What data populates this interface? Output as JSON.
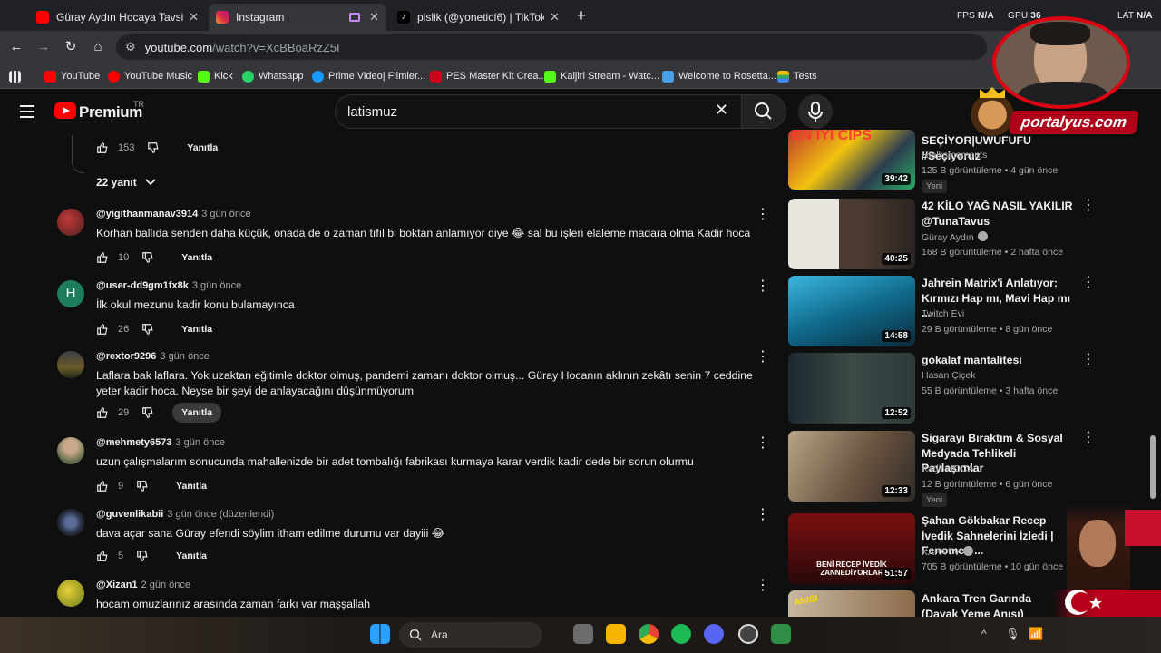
{
  "browser": {
    "tabs": [
      {
        "title": "Güray Aydın Hocaya Tavsiyemdir"
      },
      {
        "title": "Instagram"
      },
      {
        "title": "pislik (@yoneticí6) | TikTok"
      }
    ],
    "stats": {
      "fps_label": "FPS",
      "fps_value": "N/A",
      "gpu_label": "GPU",
      "gpu_value": "36",
      "lat_label": "LAT",
      "lat_value": "N/A"
    },
    "url_host": "youtube.com",
    "url_rest": "/watch?v=XcBBoaRzZ5I",
    "bookmarks": [
      "YouTube",
      "YouTube Music",
      "Kick",
      "Whatsapp",
      "Prime Video| Filmler...",
      "PES Master Kit Crea...",
      "Kaijiri Stream - Watc...",
      "Welcome to Rosetta...",
      "Tests"
    ]
  },
  "header": {
    "logo_text": "Premium",
    "region": "TR",
    "search_value": "latismuz"
  },
  "comments_top": {
    "likes": "153",
    "reply": "Yanıtla",
    "replies_toggle": "22 yanıt"
  },
  "comments": [
    {
      "handle": "@yigithanmanav3914",
      "time": "3 gün önce",
      "text": "Korhan ballıda senden daha küçük, onada de o zaman tıfıl bi boktan anlamıyor diye 😂 sal bu işleri elaleme madara olma Kadir hoca",
      "likes": "10",
      "reply": "Yanıtla"
    },
    {
      "handle": "@user-dd9gm1fx8k",
      "time": "3 gün önce",
      "text": "İlk okul mezunu kadir konu bulamayınca",
      "likes": "26",
      "reply": "Yanıtla",
      "initial": "H"
    },
    {
      "handle": "@rextor9296",
      "time": "3 gün önce",
      "text": "Laflara bak laflara. Yok uzaktan eğitimle doktor olmuş, pandemi zamanı doktor olmuş... Güray Hocanın aklının zekâtı senin 7 ceddine yeter kadir hoca. Neyse bir şeyi de anlayacağını düşünmüyorum",
      "likes": "29",
      "reply": "Yanıtla"
    },
    {
      "handle": "@mehmety6573",
      "time": "3 gün önce",
      "text": "uzun çalışmalarım sonucunda mahallenizde bir adet tombalığı fabrikası kurmaya karar verdik kadir dede bir sorun olurmu",
      "likes": "9",
      "reply": "Yanıtla"
    },
    {
      "handle": "@guvenlikabii",
      "time": "3 gün önce (düzenlendi)",
      "text": "dava açar sana Güray efendi söylim itham edilme durumu var dayiii 😂",
      "likes": "5",
      "reply": "Yanıtla"
    },
    {
      "handle": "@Xizan1",
      "time": "2 gün önce",
      "text": "hocam omuzlarınız arasında zaman farkı var maşşallah",
      "likes": "",
      "reply": ""
    }
  ],
  "sidebar": [
    {
      "title": "SEÇİYOR|UWUFUFU #Seçiyoruz",
      "channel": "Htalksmoments",
      "meta": "125 B görüntüleme • 4 gün önce",
      "badge": "Yeni",
      "duration": "39:42",
      "thumb_text": "EN İYİ CİPS",
      "verified": false
    },
    {
      "title": "42 KİLO YAĞ NASIL YAKILIR @TunaTavus",
      "channel": "Güray Aydın",
      "meta": "168 B görüntüleme • 2 hafta önce",
      "badge": "",
      "duration": "40:25",
      "thumb_text": "",
      "verified": true
    },
    {
      "title": "Jahrein Matrix'i Anlatıyor: Kırmızı Hap mı, Mavi Hap mı ...",
      "channel": "Twitch Evi",
      "meta": "29 B görüntüleme • 8 gün önce",
      "badge": "",
      "duration": "14:58",
      "thumb_text": "",
      "verified": false
    },
    {
      "title": "gokalaf mantalitesi",
      "channel": "Hasan Çiçek",
      "meta": "55 B görüntüleme • 3 hafta önce",
      "badge": "",
      "duration": "12:52",
      "thumb_text": "",
      "verified": false
    },
    {
      "title": "Sigarayı Bıraktım & Sosyal Medyada Tehlikeli Paylaşımlar",
      "channel": "Kadir HOCA",
      "meta": "12 B görüntüleme • 6 gün önce",
      "badge": "Yeni",
      "duration": "12:33",
      "thumb_text": "",
      "verified": false
    },
    {
      "title": "Şahan Gökbakar Recep İvedik Sahnelerini İzledi | Fenomen ...",
      "channel": "KAFA TV",
      "meta": "705 B görüntüleme • 10 gün önce",
      "badge": "",
      "duration": "51:57",
      "thumb_text": "BENİ RECEP İVEDİK ZANNEDİYORLAR",
      "verified": true
    },
    {
      "title": "Ankara Tren Garında (Dayak Yeme Anısı)",
      "channel": "",
      "meta": "",
      "badge": "",
      "duration": "",
      "thumb_text": "ANISI",
      "verified": false
    }
  ],
  "taskbar": {
    "search_label": "Ara"
  },
  "overlay": {
    "brand": "portalyus.com"
  },
  "colors": {
    "yt_red": "#ff0000",
    "bg": "#0f0f0f",
    "overlay_red": "#e00012"
  }
}
